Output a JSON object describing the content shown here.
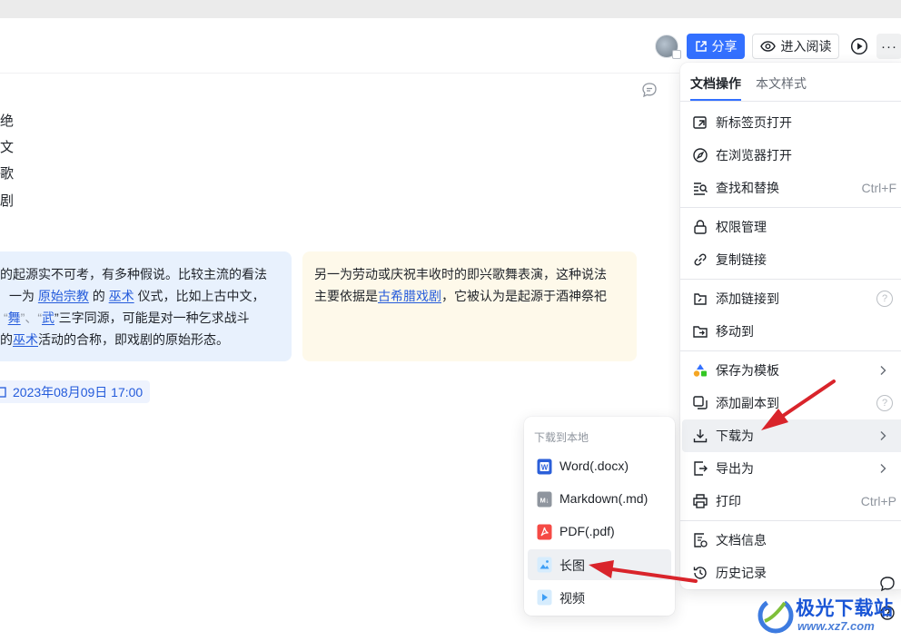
{
  "header": {
    "share_label": "分享",
    "read_label": "进入阅读",
    "more_label": "···"
  },
  "body_text": {
    "left_chars": [
      "绝",
      "文",
      "歌",
      "剧"
    ],
    "callout_blue": {
      "line1": "的起源实不可考，有多种假说。比较主流的看法",
      "line2_a": "一为",
      "line2_link1": "原始宗教",
      "line2_b": "的",
      "line2_link2": "巫术",
      "line2_c": "仪式，比如上古中文，",
      "line3_q1": "“",
      "line3_link1": "舞",
      "line3_b": "”、“",
      "line3_link2": "武",
      "line3_c": "”三字同源，可能是对一种乞求战斗",
      "line4_a": "的",
      "line4_link": "巫术",
      "line4_b": "活动的合称，即戏剧的原始形态。"
    },
    "callout_yellow": {
      "line1": "另一为劳动或庆祝丰收时的即兴歌舞表演，这种说法",
      "line2_a": "主要依据是",
      "line2_link": "古希腊戏剧",
      "line2_b": "，它被认为是起源于酒神祭祀"
    },
    "date_tag": "2023年08月09日 17:00"
  },
  "menu": {
    "tabs": [
      "文档操作",
      "本文样式"
    ],
    "items": [
      {
        "label": "新标签页打开",
        "icon": "open-new-tab-icon"
      },
      {
        "label": "在浏览器打开",
        "icon": "compass-icon"
      },
      {
        "label": "查找和替换",
        "icon": "find-replace-icon",
        "shortcut": "Ctrl+F"
      },
      {
        "label": "权限管理",
        "icon": "lock-icon"
      },
      {
        "label": "复制链接",
        "icon": "link-icon"
      },
      {
        "label": "添加链接到",
        "icon": "add-link-icon"
      },
      {
        "label": "移动到",
        "icon": "move-folder-icon"
      },
      {
        "label": "保存为模板",
        "icon": "template-icon"
      },
      {
        "label": "添加副本到",
        "icon": "copy-icon"
      },
      {
        "label": "下载为",
        "icon": "download-icon"
      },
      {
        "label": "导出为",
        "icon": "export-icon"
      },
      {
        "label": "打印",
        "icon": "printer-icon",
        "shortcut": "Ctrl+P"
      },
      {
        "label": "文档信息",
        "icon": "doc-info-icon"
      },
      {
        "label": "历史记录",
        "icon": "history-icon"
      }
    ],
    "help_glyph": "?"
  },
  "submenu": {
    "title": "下载到本地",
    "items": [
      {
        "label": "Word(.docx)",
        "icon": "word-file-icon",
        "color": "#2b5fd9",
        "glyph": "W"
      },
      {
        "label": "Markdown(.md)",
        "icon": "markdown-file-icon",
        "color": "#8f959e",
        "glyph": "M↓"
      },
      {
        "label": "PDF(.pdf)",
        "icon": "pdf-file-icon",
        "color": "#f54a45",
        "glyph": "✦"
      },
      {
        "label": "长图",
        "icon": "long-image-icon",
        "color": "#4eb3f5",
        "glyph": "▲"
      },
      {
        "label": "视频",
        "icon": "video-file-icon",
        "color": "#4eb3f5",
        "glyph": "▶"
      }
    ]
  },
  "watermark": {
    "top": "极光下载站",
    "bottom": "www.xz7.com"
  },
  "colors": {
    "accent": "#3370ff",
    "link": "#245bdb",
    "annotation_arrow": "#d9242b"
  }
}
